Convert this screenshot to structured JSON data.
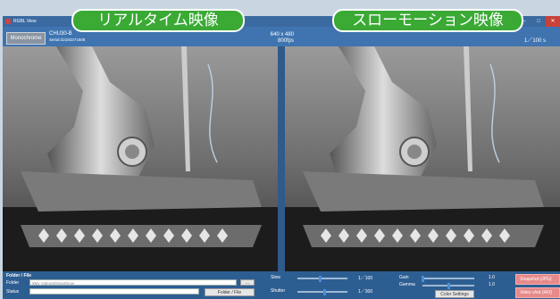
{
  "window": {
    "title": "RGBL View",
    "controls": [
      "–",
      "□",
      "✕"
    ]
  },
  "banners": {
    "realtime": "リアルタイム映像",
    "slowmotion": "スローモーション映像"
  },
  "camera": {
    "mode_button": "Monochrome",
    "model": "CHU30-B",
    "serial": "Serial:32183371608",
    "resolution": "640 x 480",
    "fps": "800fps",
    "shutter_display": "1／100 s"
  },
  "bottom": {
    "folder_title": "Folder / File",
    "folder_label": "Folder",
    "folder_value": "¥My Videos¥SlowShow",
    "status_label": "Status",
    "status_value": "",
    "browse_label": "...",
    "folder_file_button": "Folder / File",
    "slow_label": "Slow",
    "slow_value": "1／100",
    "shutter_label": "Shutter",
    "shutter_value": "1／300",
    "gain_label": "Gain",
    "gain_value": "1.0",
    "gamma_label": "Gamma",
    "gamma_value": "1.0",
    "color_settings_button": "Color Settings",
    "snapshot_button": "Snapshot (JPG)",
    "video_shot_button": "Video shot (AVI)"
  },
  "sliders": {
    "slow": 0.45,
    "shutter": 0.55,
    "gain": 0.0,
    "gamma": 0.5
  },
  "colors": {
    "banner_green": "#3aaa35",
    "panel_blue": "#2f5a8a",
    "pink_button": "#e88a8a"
  }
}
